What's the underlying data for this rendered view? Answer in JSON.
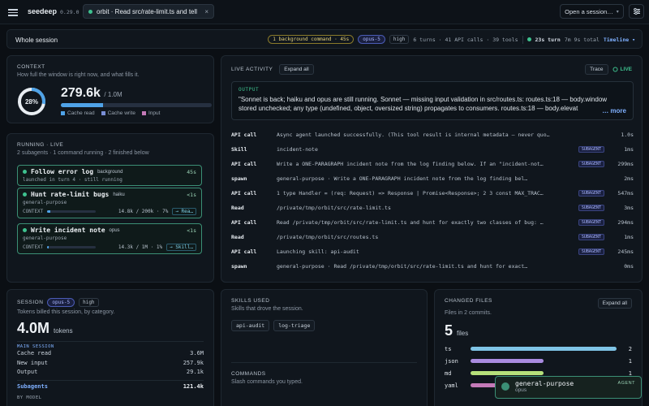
{
  "topbar": {
    "brand": "seedeep",
    "version": "0.29.0",
    "tab_title": "orbit · Read src/rate-limit.ts and tell",
    "tab_close": "×",
    "open_session": "Open a session…",
    "open_session_caret": "▾"
  },
  "session_bar": {
    "title": "Whole session",
    "background": "1 background command · 45s",
    "model": "opus-5",
    "effort": "high",
    "stats": "6 turns · 41 API calls · 39 tools",
    "turn": "23s turn",
    "total": "7m 9s total",
    "timeline": "Timeline ▾"
  },
  "context": {
    "heading": "CONTEXT",
    "subtitle": "How full the window is right now, and what fills it.",
    "percent_label": "28%",
    "percent_value": 0.28,
    "used": "279.6k",
    "limit": "/ 1.0M",
    "legend": [
      {
        "label": "Cache read",
        "color": "#4fa3e8"
      },
      {
        "label": "Cache write",
        "color": "#7a8fd6"
      },
      {
        "label": "Input",
        "color": "#c47ab8"
      }
    ]
  },
  "running": {
    "heading": "RUNNING · LIVE",
    "subtitle": "2 subagents · 1 command running · 2 finished below",
    "agents": [
      {
        "name": "Follow error log",
        "tag": "background",
        "time": "45s",
        "sub": "launched in turn 4 · still running"
      },
      {
        "name": "Hunt rate-limit bugs",
        "tag": "haiku",
        "time": "<1s",
        "sub": "general-purpose",
        "ctx_label": "CONTEXT",
        "nums": "14.8k / 200k · 7%",
        "fill": 0.07,
        "action": "→ Rea…"
      },
      {
        "name": "Write incident note",
        "tag": "opus",
        "time": "<1s",
        "sub": "general-purpose",
        "ctx_label": "CONTEXT",
        "nums": "14.3k / 1M · 1%",
        "fill": 0.01,
        "action": "→ Skill…"
      }
    ]
  },
  "live": {
    "heading": "LIVE ACTIVITY",
    "expand": "Expand all",
    "trace": "Trace",
    "live_label": "LIVE",
    "output_label": "OUTPUT",
    "output_text": "\"Sonnet is back; haiku and opus are still running. Sonnet — missing input validation in src/routes.ts: routes.ts:18 — body.window stored unchecked; any type (undefined, object, oversized string) propagates to consumers. routes.ts:18 — body.elevat",
    "more": "… more",
    "rows": [
      {
        "k": "API call",
        "d": "Async agent launched successfully. (This tool result is internal metadata — never quo…",
        "badge": "",
        "t": "1.0s"
      },
      {
        "k": "Skill",
        "d": "incident-note",
        "badge": "SUBAGENT",
        "t": "1ms"
      },
      {
        "k": "API call",
        "d": "Write a ONE-PARAGRAPH incident note from the log finding below. If an \"incident-not…",
        "badge": "SUBAGENT",
        "t": "299ms"
      },
      {
        "k": "spawn",
        "d": "general-purpose · Write a ONE-PARAGRAPH incident note from the log finding bel…",
        "badge": "",
        "t": "2ms"
      },
      {
        "k": "API call",
        "d": "1 type Handler = (req: Request) => Response | Promise<Response>; 2 3 const MAX_TRAC…",
        "badge": "SUBAGENT",
        "t": "547ms"
      },
      {
        "k": "Read",
        "d": "/private/tmp/orbit/src/rate-limit.ts",
        "badge": "SUBAGENT",
        "t": "3ms"
      },
      {
        "k": "API call",
        "d": "Read /private/tmp/orbit/src/rate-limit.ts and hunt for exactly two classes of bug: …",
        "badge": "SUBAGENT",
        "t": "294ms"
      },
      {
        "k": "Read",
        "d": "/private/tmp/orbit/src/routes.ts",
        "badge": "SUBAGENT",
        "t": "1ms"
      },
      {
        "k": "API call",
        "d": "Launching skill: api-audit",
        "badge": "SUBAGENT",
        "t": "245ms"
      },
      {
        "k": "spawn",
        "d": "general-purpose · Read /private/tmp/orbit/src/rate-limit.ts and hunt for exact…",
        "badge": "",
        "t": "0ms"
      }
    ]
  },
  "session": {
    "heading": "SESSION",
    "model": "opus-5",
    "effort": "high",
    "subtitle": "Tokens billed this session, by category.",
    "total": "4.0M",
    "unit": "tokens",
    "main_label": "MAIN SESSION",
    "main": [
      {
        "k": "Cache read",
        "v": "3.6M"
      },
      {
        "k": "New input",
        "v": "257.9k"
      },
      {
        "k": "Output",
        "v": "29.1k"
      }
    ],
    "subagents_label": "Subagents",
    "subagents_value": "121.4k",
    "by_model": "BY MODEL"
  },
  "skills": {
    "heading": "SKILLS USED",
    "subtitle": "Skills that drove the session.",
    "items": [
      "api-audit",
      "log-triage"
    ],
    "commands_heading": "COMMANDS",
    "commands_subtitle": "Slash commands you typed."
  },
  "changed": {
    "heading": "CHANGED FILES",
    "expand": "Expand all",
    "subtitle": "Files in 2 commits.",
    "count": "5",
    "unit": "files",
    "files": [
      {
        "ext": "ts",
        "n": "2",
        "fill": 1.0,
        "color": "#7fc4e6"
      },
      {
        "ext": "json",
        "n": "1",
        "fill": 0.5,
        "color": "#a98be0"
      },
      {
        "ext": "md",
        "n": "1",
        "fill": 0.5,
        "color": "#b6e07a"
      },
      {
        "ext": "yaml",
        "n": "1",
        "fill": 0.5,
        "color": "#c47ab8"
      }
    ]
  },
  "toast": {
    "name": "general-purpose",
    "model": "opus",
    "kind": "AGENT"
  }
}
